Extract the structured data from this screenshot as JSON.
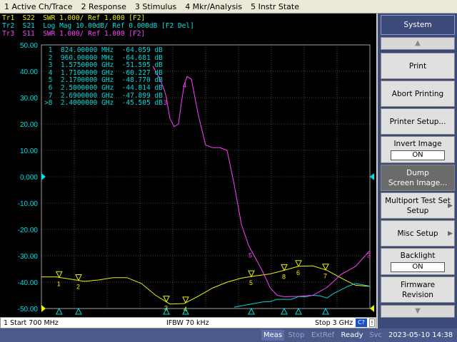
{
  "menu": [
    "1 Active Ch/Trace",
    "2 Response",
    "3 Stimulus",
    "4 Mkr/Analysis",
    "5 Instr State"
  ],
  "traces": [
    {
      "id": "Tr1",
      "text": "Tr1  S22  SWR 1.000/ Ref 1.000 [F2]",
      "color": "#f0f000"
    },
    {
      "id": "Tr2",
      "text": "Tr2  S21  Log Mag 10.00dB/ Ref 0.000dB [F2 Del]",
      "color": "#00e0e0"
    },
    {
      "id": "Tr3",
      "text": "Tr3  S11  SWR 1.000/ Ref 1.000 [F2]",
      "color": "#ff40ff"
    }
  ],
  "yticks": [
    "50.00",
    "40.00",
    "30.00",
    "20.00",
    "10.00",
    "0.000",
    "-10.00",
    "-20.00",
    "-30.00",
    "-40.00",
    "-50.00"
  ],
  "markers": [
    {
      "n": "1",
      "freq": "824.00000 MHz",
      "val": "-64.059 dB"
    },
    {
      "n": "2",
      "freq": "960.00000 MHz",
      "val": "-64.681 dB"
    },
    {
      "n": "3",
      "freq": "1.5750000 GHz",
      "val": "-51.595 dB"
    },
    {
      "n": "4",
      "freq": "1.7100000 GHz",
      "val": "-60.227 dB"
    },
    {
      "n": "5",
      "freq": "2.1700000 GHz",
      "val": "-48.770 dB"
    },
    {
      "n": "6",
      "freq": "2.5000000 GHz",
      "val": "-44.814 dB"
    },
    {
      "n": "7",
      "freq": "2.6900000 GHz",
      "val": "-47.899 dB"
    },
    {
      "n": ">8",
      "freq": "2.4000000 GHz",
      "val": "-45.505 dB"
    }
  ],
  "status": {
    "start": "1  Start 700 MHz",
    "ifbw": "IFBW 70 kHz",
    "stop": "Stop 3 GHz",
    "c_btn": "C?",
    "i_btn": "!"
  },
  "bottom": {
    "meas": "Meas",
    "stop": "Stop",
    "extref": "ExtRef",
    "ready": "Ready",
    "svc": "Svc",
    "datetime": "2023-05-10 14:38"
  },
  "softkeys": {
    "title": "System",
    "print": "Print",
    "abort": "Abort Printing",
    "printer_setup": "Printer Setup...",
    "invert_label": "Invert Image",
    "invert_val": "ON",
    "dump_l1": "Dump",
    "dump_l2": "Screen Image...",
    "multiport_l1": "Multiport Test Set",
    "multiport_l2": "Setup",
    "misc": "Misc Setup",
    "backlight_label": "Backlight",
    "backlight_val": "ON",
    "firmware_l1": "Firmware",
    "firmware_l2": "Revision"
  },
  "icons": {
    "scroll_up": "triangle-up-icon",
    "scroll_down": "triangle-down-icon",
    "submenu": "chevron-right-icon"
  },
  "chart_data": {
    "type": "line",
    "xlim_hz": [
      700000000,
      3000000000
    ],
    "ylim": [
      -50,
      50
    ],
    "ref_value": 0,
    "series": [
      {
        "name": "Tr1",
        "color": "#f0f000",
        "x_ghz": [
          0.7,
          0.8,
          0.9,
          1.0,
          1.1,
          1.2,
          1.3,
          1.4,
          1.5,
          1.6,
          1.7,
          1.8,
          1.9,
          2.0,
          2.1,
          2.2,
          2.3,
          2.4,
          2.5,
          2.6,
          2.7,
          2.8,
          2.9,
          3.0
        ],
        "y": [
          -38,
          -38,
          -38.8,
          -39.7,
          -39.2,
          -38.3,
          -38.3,
          -40.5,
          -45.0,
          -48.3,
          -48.1,
          -45.3,
          -42.2,
          -40.0,
          -38.5,
          -37.6,
          -36.9,
          -35.5,
          -34.0,
          -33.8,
          -35.5,
          -38.5,
          -41.2,
          -41.6
        ]
      },
      {
        "name": "Tr2",
        "color": "#00d8d8",
        "x_ghz": [
          2.05,
          2.1,
          2.15,
          2.2,
          2.25,
          2.3,
          2.35,
          2.4,
          2.45,
          2.5,
          2.55,
          2.6,
          2.65,
          2.7,
          2.75,
          2.8,
          2.85,
          2.9,
          2.95,
          3.0
        ],
        "y": [
          -49.5,
          -49.0,
          -48.5,
          -48.0,
          -47.5,
          -47.4,
          -46.5,
          -46.5,
          -46.5,
          -45.5,
          -45.5,
          -45.0,
          -45.2,
          -46.0,
          -44.2,
          -42.8,
          -41.5,
          -40.5,
          -41.0,
          -41.5
        ]
      },
      {
        "name": "Tr3",
        "color": "#ff40ff",
        "x_ghz": [
          1.48,
          1.5,
          1.53,
          1.56,
          1.575,
          1.6,
          1.63,
          1.66,
          1.68,
          1.7,
          1.72,
          1.75,
          1.8,
          1.85,
          1.9,
          1.95,
          2.0,
          2.05,
          2.1,
          2.15,
          2.2,
          2.25,
          2.3,
          2.35,
          2.4,
          2.5,
          2.6,
          2.7,
          2.8,
          2.9,
          3.0
        ],
        "y": [
          42,
          40,
          37,
          33,
          30,
          22,
          19,
          20,
          28,
          35,
          38,
          37,
          23,
          12,
          11,
          11,
          10,
          -3,
          -18,
          -26,
          -31,
          -36,
          -42,
          -45,
          -45.5,
          -45.4,
          -45.0,
          -42,
          -37,
          -34,
          -28
        ]
      }
    ],
    "marker_x_ghz": [
      0.824,
      0.96,
      1.575,
      1.71,
      2.17,
      2.5,
      2.69,
      2.4
    ]
  }
}
